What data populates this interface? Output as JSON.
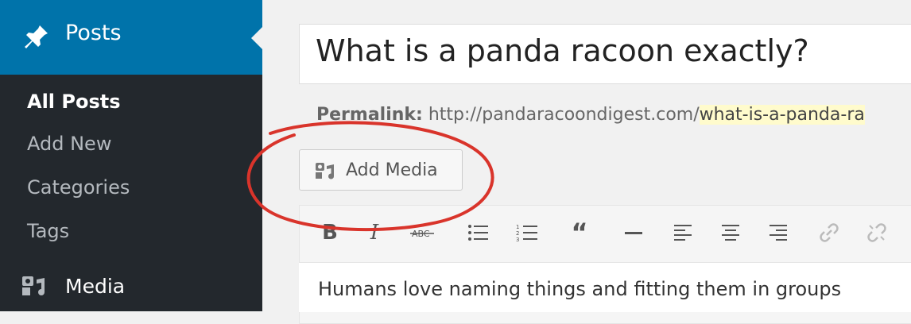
{
  "sidebar": {
    "posts_label": "Posts",
    "submenu": [
      {
        "label": "All Posts",
        "current": true
      },
      {
        "label": "Add New"
      },
      {
        "label": "Categories"
      },
      {
        "label": "Tags"
      }
    ],
    "media_label": "Media"
  },
  "editor": {
    "title": "What is a panda racoon exactly?",
    "permalink_label": "Permalink:",
    "permalink_base": "http://pandaracoondigest.com/",
    "permalink_slug": "what-is-a-panda-ra",
    "add_media_label": "Add Media",
    "content_preview": "Humans love naming things and fitting them in groups"
  },
  "toolbar_icons": [
    "bold-icon",
    "italic-icon",
    "strikethrough-icon",
    "bulleted-list-icon",
    "numbered-list-icon",
    "blockquote-icon",
    "horizontal-line-icon",
    "align-left-icon",
    "align-center-icon",
    "align-right-icon",
    "link-icon",
    "unlink-icon"
  ],
  "colors": {
    "accent": "#0073aa",
    "sidebar_dark": "#23282d",
    "annotation_red": "#d9342b",
    "slug_highlight": "#fffbcc"
  }
}
